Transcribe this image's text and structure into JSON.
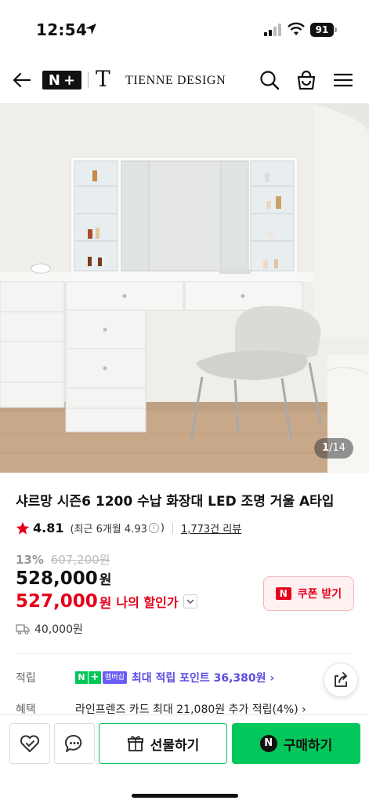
{
  "status_bar": {
    "time": "12:54",
    "battery": "91"
  },
  "header": {
    "logo_mark": "T",
    "brand_name": "TIENNE DESIGN"
  },
  "image": {
    "current": "1",
    "total": "/14"
  },
  "product": {
    "title": "샤르망 시즌6 1200 수납 화장대 LED 조명 거울 A타입",
    "rating": "4.81",
    "rating_recent": "(최근 6개월 4.93",
    "rating_recent_close": ")",
    "review_count": "1,773건 리뷰",
    "discount_pct": "13%",
    "original_price": "607,200원",
    "price": "528,000",
    "price_unit": "원",
    "my_price": "527,000",
    "my_price_unit": "원",
    "my_price_label": "나의 할인가",
    "coupon_label": "쿠폰 받기",
    "shipping": "40,000원"
  },
  "points": {
    "label": "적립",
    "badge_member": "멤버십",
    "text": "최대 적립 포인트 36,380원 ›"
  },
  "benefit": {
    "label": "혜택",
    "text": "라인프렌즈 카드 최대 21,080원 추가 적립(4%) ›"
  },
  "bottom": {
    "gift_label": "선물하기",
    "buy_label": "구매하기"
  },
  "colors": {
    "naver_green": "#03c75a",
    "sale_red": "#e5001a",
    "points_purple": "#5a4de0"
  }
}
